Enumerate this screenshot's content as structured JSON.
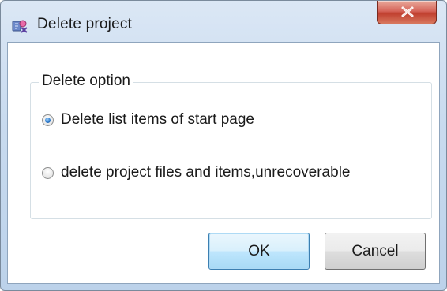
{
  "window": {
    "title": "Delete project",
    "close_label": "X"
  },
  "group": {
    "legend": "Delete option",
    "options": [
      {
        "label": "Delete list items of start page",
        "checked": true
      },
      {
        "label": "delete project files and items,unrecoverable",
        "checked": false
      }
    ]
  },
  "buttons": {
    "ok_label": "OK",
    "cancel_label": "Cancel"
  },
  "icons": {
    "app": "app-icon",
    "close": "close-icon"
  },
  "colors": {
    "titlebar": "#c9dbef",
    "close_button": "#c03f2f",
    "default_button": "#bee6fd",
    "radio_selected": "#2c78c8"
  }
}
